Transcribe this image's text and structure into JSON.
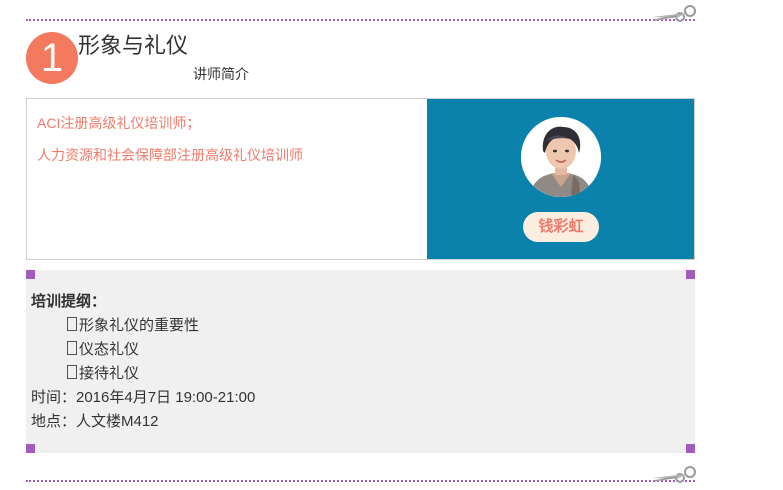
{
  "section": {
    "number": "1",
    "title": "形象与礼仪",
    "subtitle": "讲师简介"
  },
  "lecturer": {
    "credentials": [
      "ACI注册高级礼仪培训师；",
      "人力资源和社会保障部注册高级礼仪培训师"
    ],
    "name": "钱彩虹",
    "photo": "lecturer-portrait"
  },
  "outline": {
    "heading": "培训提纲：",
    "items": [
      "形象礼仪的重要性",
      "仪态礼仪",
      "接待礼仪"
    ],
    "time": "时间：2016年4月7日 19:00-21:00",
    "location": "地点：人文楼M412"
  },
  "colors": {
    "accent": "#f47a5f",
    "divider": "#a35bbd",
    "photo_panel": "#0a82ac",
    "credential_text": "#f07b6a",
    "outline_bg": "#f0f0f0"
  },
  "icons": {
    "divider_decoration": "scissors-icon",
    "list_bullet": "checkbox-bullet-icon"
  }
}
